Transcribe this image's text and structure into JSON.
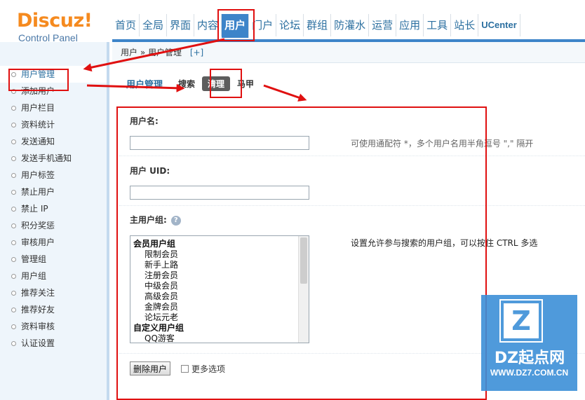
{
  "logo": {
    "main": "Discuz!",
    "sub": "Control Panel"
  },
  "topnav": {
    "items": [
      "首页",
      "全局",
      "界面",
      "内容",
      "用户",
      "门户",
      "论坛",
      "群组",
      "防灌水",
      "运营",
      "应用",
      "工具",
      "站长",
      "UCenter"
    ],
    "active": "用户"
  },
  "breadcrumb": {
    "text": "用户 » 用户管理",
    "plus": "[+]"
  },
  "sidebar": {
    "items": [
      "用户管理",
      "添加用户",
      "用户栏目",
      "资料统计",
      "发送通知",
      "发送手机通知",
      "用户标签",
      "禁止用户",
      "禁止 IP",
      "积分奖惩",
      "审核用户",
      "管理组",
      "用户组",
      "推荐关注",
      "推荐好友",
      "资料审核",
      "认证设置"
    ],
    "active": "用户管理"
  },
  "tabs": {
    "title": "用户管理",
    "items": [
      "搜索",
      "清理",
      "马甲"
    ],
    "active": "清理"
  },
  "form": {
    "username_label": "用户名:",
    "username_value": "",
    "username_hint": "可使用通配符 *，多个用户名用半角逗号 \",\" 隔开",
    "uid_label": "用户 UID:",
    "uid_value": "",
    "group_label": "主用户组:",
    "group_hint": "设置允许参与搜索的用户组，可以按住 CTRL 多选",
    "groups": [
      {
        "label": "会员用户组",
        "kind": "head"
      },
      {
        "label": "限制会员",
        "kind": "sub"
      },
      {
        "label": "新手上路",
        "kind": "sub"
      },
      {
        "label": "注册会员",
        "kind": "sub"
      },
      {
        "label": "中级会员",
        "kind": "sub"
      },
      {
        "label": "高级会员",
        "kind": "sub"
      },
      {
        "label": "金牌会员",
        "kind": "sub"
      },
      {
        "label": "论坛元老",
        "kind": "sub"
      },
      {
        "label": "自定义用户组",
        "kind": "head"
      },
      {
        "label": "QQ游客",
        "kind": "sub"
      }
    ],
    "delete_button": "删除用户",
    "more_options": "更多选项"
  },
  "watermark": {
    "mark": "Z",
    "brand": "DZ起点网",
    "site": "WWW.DZ7.COM.CN"
  },
  "colors": {
    "accent": "#3d84c9",
    "logo": "#f58a1f",
    "annotation": "#e01010"
  }
}
